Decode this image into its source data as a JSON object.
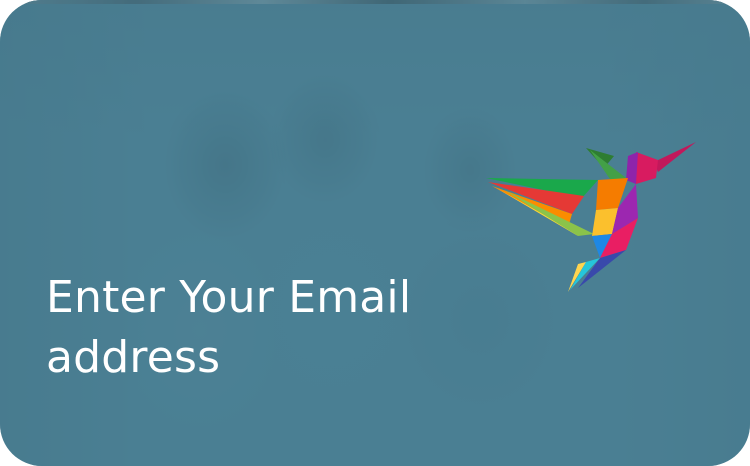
{
  "hero": {
    "heading_line1": "Enter Your Email",
    "heading_line2": "address"
  },
  "colors": {
    "overlay": "#4a7f93",
    "text": "#ffffff"
  },
  "icons": {
    "logo": "hummingbird-logo-icon"
  }
}
